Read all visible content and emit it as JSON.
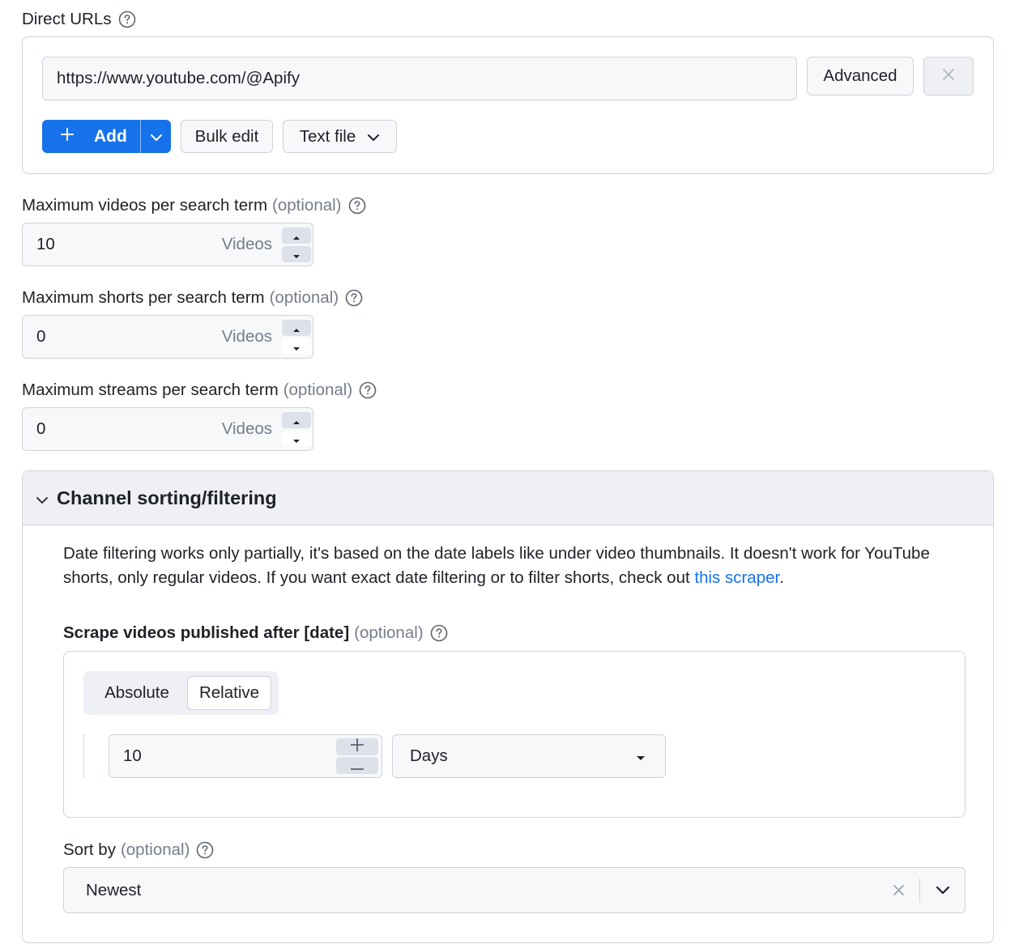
{
  "direct_urls": {
    "label": "Direct URLs",
    "url_value": "https://www.youtube.com/@Apify",
    "advanced_label": "Advanced",
    "add_label": "Add",
    "bulk_edit_label": "Bulk edit",
    "text_file_label": "Text file"
  },
  "max_videos": {
    "label": "Maximum videos per search term",
    "optional": "(optional)",
    "value": "10",
    "unit": "Videos"
  },
  "max_shorts": {
    "label": "Maximum shorts per search term",
    "optional": "(optional)",
    "value": "0",
    "unit": "Videos"
  },
  "max_streams": {
    "label": "Maximum streams per search term",
    "optional": "(optional)",
    "value": "0",
    "unit": "Videos"
  },
  "channel_section": {
    "title": "Channel sorting/filtering",
    "description_line1": "Date filtering works only partially, it's based on the date labels like under video thumbnails. It doesn't work for YouTube",
    "description_line2_prefix": "shorts, only regular videos. If you want exact date filtering or to filter shorts, check out ",
    "description_link": "this scraper",
    "description_suffix": ".",
    "date_label": "Scrape videos published after [date]",
    "date_optional": "(optional)",
    "mode_absolute": "Absolute",
    "mode_relative": "Relative",
    "relative_value": "10",
    "relative_unit": "Days",
    "sort_label": "Sort by",
    "sort_optional": "(optional)",
    "sort_value": "Newest"
  },
  "colors": {
    "primary": "#1672eb",
    "border": "#cfd3da",
    "muted": "#767c8a",
    "section_bg": "#eef0f6"
  },
  "icons": [
    "help-icon",
    "plus-icon",
    "chevron-down-icon",
    "close-icon",
    "caret-up-icon",
    "caret-down-icon",
    "minus-icon",
    "triangle-down-icon"
  ]
}
